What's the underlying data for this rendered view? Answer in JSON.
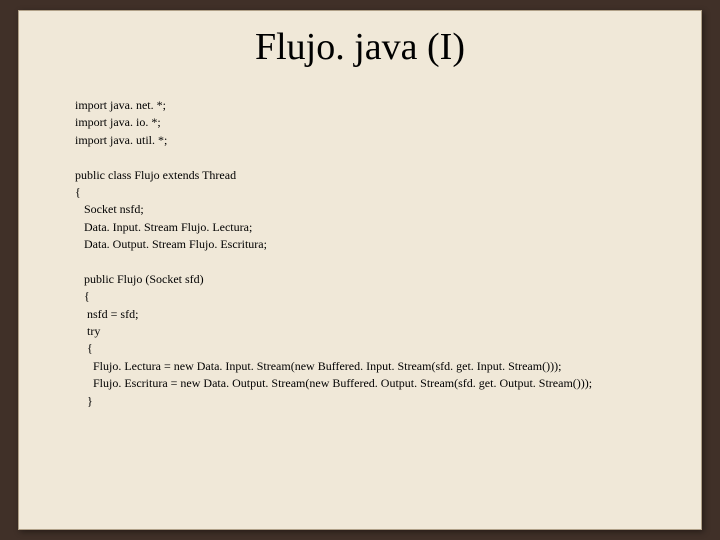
{
  "slide": {
    "title": "Flujo. java (I)",
    "code": {
      "l1": "import java. net. *;",
      "l2": "import java. io. *;",
      "l3": "import java. util. *;",
      "l4": "public class Flujo extends Thread",
      "l5": "{",
      "l6": "   Socket nsfd;",
      "l7": "   Data. Input. Stream Flujo. Lectura;",
      "l8": "   Data. Output. Stream Flujo. Escritura;",
      "l9": "   public Flujo (Socket sfd)",
      "l10": "   {",
      "l11": "    nsfd = sfd;",
      "l12": "    try",
      "l13": "    {",
      "l14": "      Flujo. Lectura = new Data. Input. Stream(new Buffered. Input. Stream(sfd. get. Input. Stream()));",
      "l15": "      Flujo. Escritura = new Data. Output. Stream(new Buffered. Output. Stream(sfd. get. Output. Stream()));",
      "l16": "    }"
    }
  }
}
